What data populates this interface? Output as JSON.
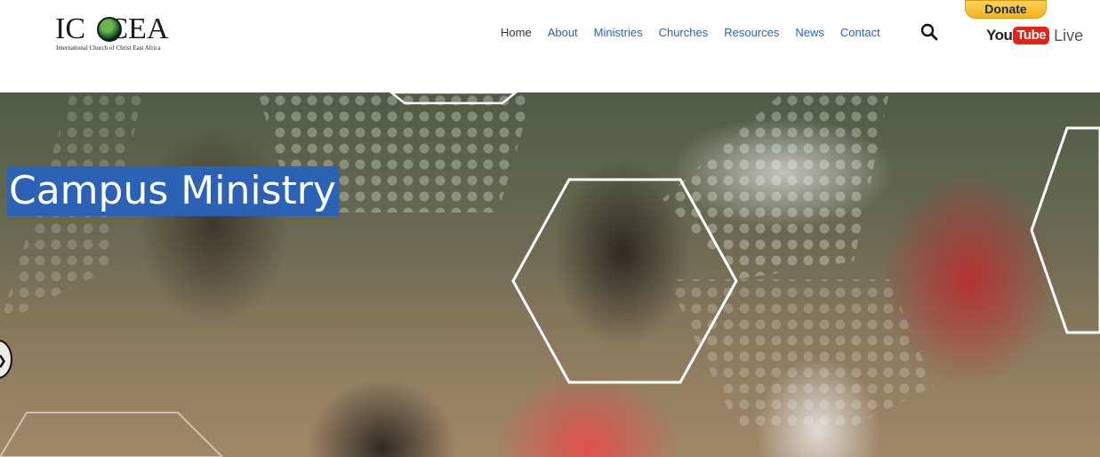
{
  "logo": {
    "title": "ICOCEA",
    "subtitle": "International Church of Christ East Africa"
  },
  "nav": {
    "items": [
      {
        "label": "Home",
        "active": true
      },
      {
        "label": "About",
        "active": false
      },
      {
        "label": "Ministries",
        "active": false
      },
      {
        "label": "Churches",
        "active": false
      },
      {
        "label": "Resources",
        "active": false
      },
      {
        "label": "News",
        "active": false
      },
      {
        "label": "Contact",
        "active": false
      }
    ]
  },
  "header": {
    "search_icon": "search-icon",
    "donate_label": "Donate",
    "youtube": {
      "you": "You",
      "tube": "Tube",
      "live": "Live"
    }
  },
  "hero": {
    "title": "Campus Ministry",
    "prev_icon": "chevron-right-icon"
  },
  "colors": {
    "nav_link": "#2a63b0",
    "title_bg": "#2b62b5",
    "donate": "#f6b31a",
    "youtube_red": "#e62117"
  }
}
